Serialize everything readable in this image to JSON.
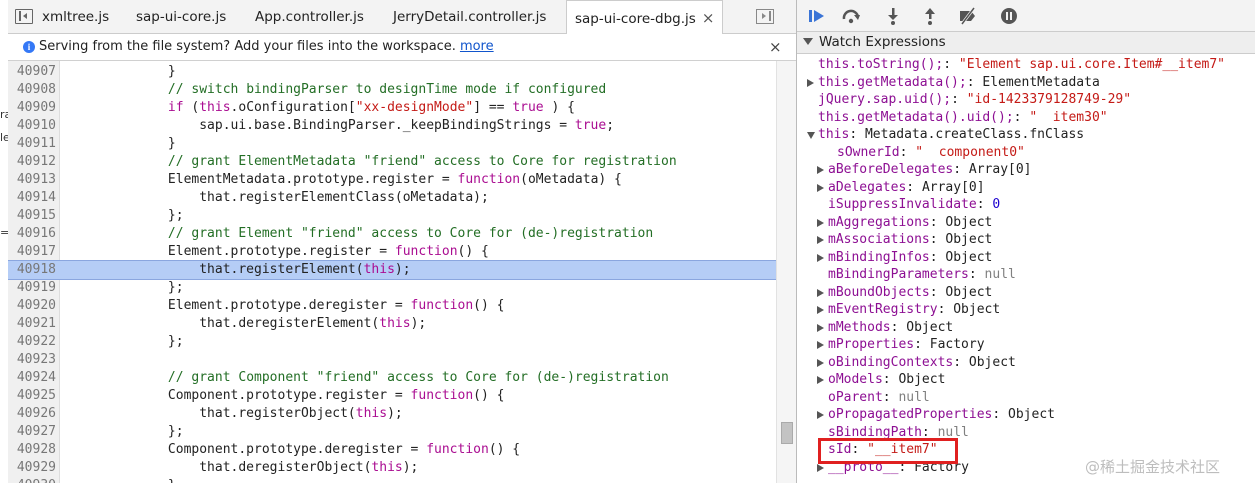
{
  "left_strip": {
    "fragments": [
      "ra",
      "le",
      "=s"
    ]
  },
  "tabs": [
    {
      "label": "xmltree.js"
    },
    {
      "label": "sap-ui-core.js"
    },
    {
      "label": "App.controller.js"
    },
    {
      "label": "JerryDetail.controller.js"
    },
    {
      "label": "sap-ui-core-dbg.js",
      "close": "×"
    }
  ],
  "infobar": {
    "text": "Serving from the file system? Add your files into the workspace.",
    "link": "more",
    "close": "×",
    "icon": "info-icon"
  },
  "code": {
    "highlighted_line": "40918",
    "lines": [
      {
        "n": "40907",
        "t": "            }"
      },
      {
        "n": "40908",
        "t": "            // switch bindingParser to designTime mode if configured"
      },
      {
        "n": "40909",
        "t": "            if (this.oConfiguration[\"xx-designMode\"] == true ) {"
      },
      {
        "n": "40910",
        "t": "                sap.ui.base.BindingParser._keepBindingStrings = true;"
      },
      {
        "n": "40911",
        "t": "            }"
      },
      {
        "n": "40912",
        "t": "            // grant ElementMetadata \"friend\" access to Core for registration"
      },
      {
        "n": "40913",
        "t": "            ElementMetadata.prototype.register = function(oMetadata) {"
      },
      {
        "n": "40914",
        "t": "                that.registerElementClass(oMetadata);"
      },
      {
        "n": "40915",
        "t": "            };"
      },
      {
        "n": "40916",
        "t": "            // grant Element \"friend\" access to Core for (de-)registration"
      },
      {
        "n": "40917",
        "t": "            Element.prototype.register = function() {"
      },
      {
        "n": "40918",
        "t": "                that.registerElement(this);"
      },
      {
        "n": "40919",
        "t": "            };"
      },
      {
        "n": "40920",
        "t": "            Element.prototype.deregister = function() {"
      },
      {
        "n": "40921",
        "t": "                that.deregisterElement(this);"
      },
      {
        "n": "40922",
        "t": "            };"
      },
      {
        "n": "40923",
        "t": ""
      },
      {
        "n": "40924",
        "t": "            // grant Component \"friend\" access to Core for (de-)registration"
      },
      {
        "n": "40925",
        "t": "            Component.prototype.register = function() {"
      },
      {
        "n": "40926",
        "t": "                that.registerObject(this);"
      },
      {
        "n": "40927",
        "t": "            };"
      },
      {
        "n": "40928",
        "t": "            Component.prototype.deregister = function() {"
      },
      {
        "n": "40929",
        "t": "                that.deregisterObject(this);"
      },
      {
        "n": "40930",
        "t": "            }"
      }
    ]
  },
  "debugger_toolbar": [
    "resume-icon",
    "step-over-icon",
    "step-into-icon",
    "step-out-icon",
    "deactivate-breakpoints-icon",
    "pause-on-exceptions-icon"
  ],
  "watch": {
    "title": "Watch Expressions",
    "items": [
      {
        "key": "this.toString();",
        "sep": ": ",
        "val": "\"Element sap.ui.core.Item#__item7\"",
        "type": "str",
        "indent": 0,
        "arrow": ""
      },
      {
        "key": "this.getMetadata();",
        "sep": ": ",
        "val": "ElementMetadata",
        "type": "obj",
        "indent": 0,
        "arrow": "right"
      },
      {
        "key": "jQuery.sap.uid();",
        "sep": ": ",
        "val": "\"id-1423379128749-29\"",
        "type": "str",
        "indent": 0,
        "arrow": ""
      },
      {
        "key": "this.getMetadata().uid();",
        "sep": ": ",
        "val": "\"  item30\"",
        "type": "str",
        "indent": 0,
        "arrow": ""
      },
      {
        "key": "this",
        "sep": ": ",
        "val": "Metadata.createClass.fnClass",
        "type": "obj",
        "indent": 0,
        "arrow": "down"
      },
      {
        "key": "sOwnerId",
        "sep": ": ",
        "val": "\"  component0\"",
        "type": "str",
        "indent": 2,
        "arrow": ""
      },
      {
        "key": "aBeforeDelegates",
        "sep": ": ",
        "val": "Array[0]",
        "type": "obj",
        "indent": 1,
        "arrow": "right"
      },
      {
        "key": "aDelegates",
        "sep": ": ",
        "val": "Array[0]",
        "type": "obj",
        "indent": 1,
        "arrow": "right"
      },
      {
        "key": "iSuppressInvalidate",
        "sep": ": ",
        "val": "0",
        "type": "num",
        "indent": 1,
        "arrow": ""
      },
      {
        "key": "mAggregations",
        "sep": ": ",
        "val": "Object",
        "type": "obj",
        "indent": 1,
        "arrow": "right"
      },
      {
        "key": "mAssociations",
        "sep": ": ",
        "val": "Object",
        "type": "obj",
        "indent": 1,
        "arrow": "right"
      },
      {
        "key": "mBindingInfos",
        "sep": ": ",
        "val": "Object",
        "type": "obj",
        "indent": 1,
        "arrow": "right"
      },
      {
        "key": "mBindingParameters",
        "sep": ": ",
        "val": "null",
        "type": "nul",
        "indent": 1,
        "arrow": ""
      },
      {
        "key": "mBoundObjects",
        "sep": ": ",
        "val": "Object",
        "type": "obj",
        "indent": 1,
        "arrow": "right"
      },
      {
        "key": "mEventRegistry",
        "sep": ": ",
        "val": "Object",
        "type": "obj",
        "indent": 1,
        "arrow": "right"
      },
      {
        "key": "mMethods",
        "sep": ": ",
        "val": "Object",
        "type": "obj",
        "indent": 1,
        "arrow": "right"
      },
      {
        "key": "mProperties",
        "sep": ": ",
        "val": "Factory",
        "type": "obj",
        "indent": 1,
        "arrow": "right"
      },
      {
        "key": "oBindingContexts",
        "sep": ": ",
        "val": "Object",
        "type": "obj",
        "indent": 1,
        "arrow": "right"
      },
      {
        "key": "oModels",
        "sep": ": ",
        "val": "Object",
        "type": "obj",
        "indent": 1,
        "arrow": "right"
      },
      {
        "key": "oParent",
        "sep": ": ",
        "val": "null",
        "type": "nul",
        "indent": 1,
        "arrow": ""
      },
      {
        "key": "oPropagatedProperties",
        "sep": ": ",
        "val": "Object",
        "type": "obj",
        "indent": 1,
        "arrow": "right"
      },
      {
        "key": "sBindingPath",
        "sep": ": ",
        "val": "null",
        "type": "nul",
        "indent": 1,
        "arrow": ""
      },
      {
        "key": "sId",
        "sep": ": ",
        "val": "\"__item7\"",
        "type": "str",
        "indent": 1,
        "arrow": ""
      },
      {
        "key": "__proto__",
        "sep": ": ",
        "val": "Factory",
        "type": "obj",
        "indent": 1,
        "arrow": "right"
      }
    ]
  },
  "watermark": "@稀土掘金技术社区",
  "colors": {
    "highlight": "#b5cdf6",
    "annotation_box": "#e02020",
    "comment": "#236e25",
    "keyword": "#aa0d91",
    "string": "#c41a16"
  }
}
